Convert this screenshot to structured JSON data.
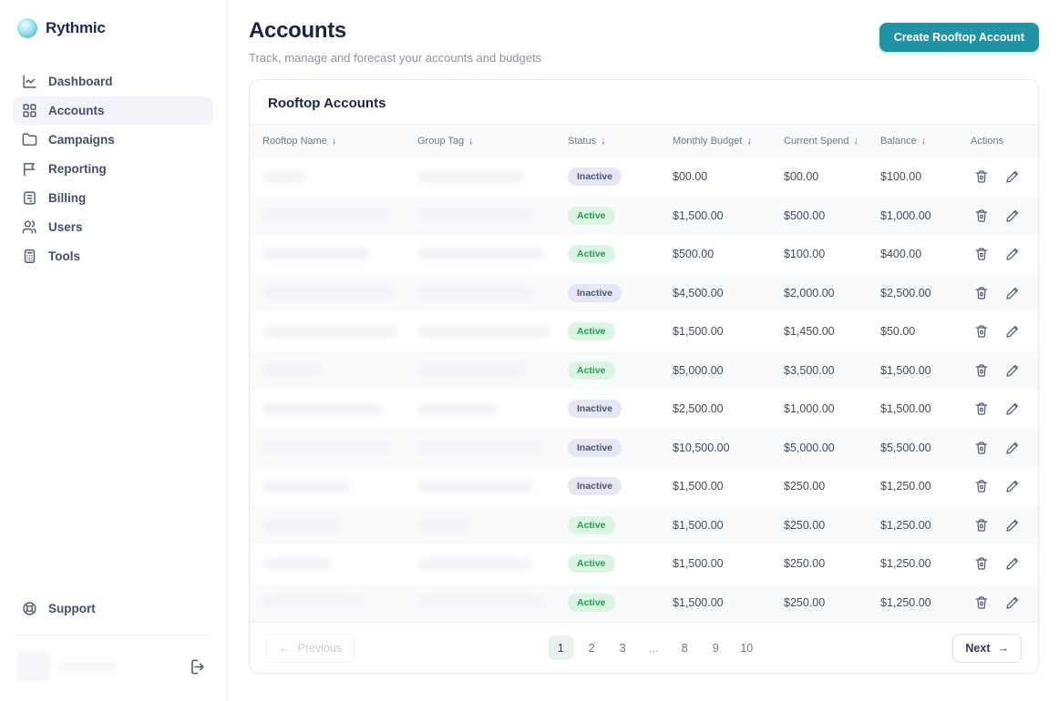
{
  "brand": {
    "name": "Rythmic"
  },
  "sidebar": {
    "items": [
      {
        "label": "Dashboard",
        "icon": "chart-line-icon",
        "active": false
      },
      {
        "label": "Accounts",
        "icon": "grid-icon",
        "active": true
      },
      {
        "label": "Campaigns",
        "icon": "folder-icon",
        "active": false
      },
      {
        "label": "Reporting",
        "icon": "flag-icon",
        "active": false
      },
      {
        "label": "Billing",
        "icon": "billing-doc-icon",
        "active": false
      },
      {
        "label": "Users",
        "icon": "users-icon",
        "active": false
      },
      {
        "label": "Tools",
        "icon": "calculator-icon",
        "active": false
      }
    ],
    "support_label": "Support"
  },
  "header": {
    "title": "Accounts",
    "subtitle": "Track, manage and forecast your accounts and budgets",
    "create_button_label": "Create Rooftop Account"
  },
  "table": {
    "title": "Rooftop Accounts",
    "sort_arrow": "↓",
    "columns": [
      {
        "label": "Rooftop Name",
        "sortable": true
      },
      {
        "label": "Group Tag",
        "sortable": true
      },
      {
        "label": "Status",
        "sortable": true
      },
      {
        "label": "Monthly Budget",
        "sortable": true
      },
      {
        "label": "Current Spend",
        "sortable": true
      },
      {
        "label": "Balance",
        "sortable": true
      },
      {
        "label": "Actions",
        "sortable": false
      }
    ],
    "rows": [
      {
        "status": "Inactive",
        "monthly_budget": "$00.00",
        "current_spend": "$00.00",
        "balance": "$100.00"
      },
      {
        "status": "Active",
        "monthly_budget": "$1,500.00",
        "current_spend": "$500.00",
        "balance": "$1,000.00"
      },
      {
        "status": "Active",
        "monthly_budget": "$500.00",
        "current_spend": "$100.00",
        "balance": "$400.00"
      },
      {
        "status": "Inactive",
        "monthly_budget": "$4,500.00",
        "current_spend": "$2,000.00",
        "balance": "$2,500.00"
      },
      {
        "status": "Active",
        "monthly_budget": "$1,500.00",
        "current_spend": "$1,450.00",
        "balance": "$50.00"
      },
      {
        "status": "Active",
        "monthly_budget": "$5,000.00",
        "current_spend": "$3,500.00",
        "balance": "$1,500.00"
      },
      {
        "status": "Inactive",
        "monthly_budget": "$2,500.00",
        "current_spend": "$1,000.00",
        "balance": "$1,500.00"
      },
      {
        "status": "Inactive",
        "monthly_budget": "$10,500.00",
        "current_spend": "$5,000.00",
        "balance": "$5,500.00"
      },
      {
        "status": "Inactive",
        "monthly_budget": "$1,500.00",
        "current_spend": "$250.00",
        "balance": "$1,250.00"
      },
      {
        "status": "Active",
        "monthly_budget": "$1,500.00",
        "current_spend": "$250.00",
        "balance": "$1,250.00"
      },
      {
        "status": "Active",
        "monthly_budget": "$1,500.00",
        "current_spend": "$250.00",
        "balance": "$1,250.00"
      },
      {
        "status": "Active",
        "monthly_budget": "$1,500.00",
        "current_spend": "$250.00",
        "balance": "$1,250.00"
      }
    ]
  },
  "pagination": {
    "prev_arrow": "←",
    "previous_label": "Previous",
    "pages": [
      "1",
      "2",
      "3",
      "...",
      "8",
      "9",
      "10"
    ],
    "active_page": "1",
    "next_label": "Next",
    "next_arrow": "→"
  },
  "colors": {
    "accent_teal": "#1f92a3",
    "active_badge_bg": "#dcf4e3",
    "active_badge_text": "#17a34a",
    "inactive_badge_bg": "#e5e8f4",
    "inactive_badge_text": "#4c566f",
    "active_page_bg": "#e7f1f1"
  }
}
